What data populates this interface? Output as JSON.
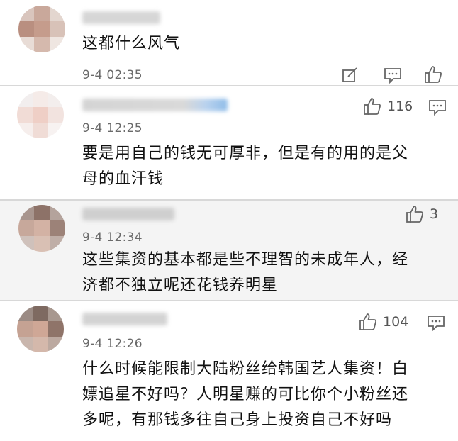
{
  "comments": [
    {
      "text_lines": [
        "这都什么风气"
      ],
      "time": "9-4 02:35",
      "likes": "",
      "icons": [
        "edit-icon",
        "comment-icon",
        "thumbs-up-icon"
      ]
    },
    {
      "text_lines": [
        "要是用自己的钱无可厚非，但是有的用的是父",
        "母的血汗钱"
      ],
      "time": "9-4 12:25",
      "likes": "116",
      "icons": [
        "thumbs-up-icon",
        "comment-icon"
      ]
    },
    {
      "text_lines": [
        "这些集资的基本都是些不理智的未成年人，经",
        "济都不独立呢还花钱养明星"
      ],
      "time": "9-4 12:34",
      "likes": "3",
      "icons": [
        "thumbs-up-icon"
      ]
    },
    {
      "text_lines": [
        "什么时候能限制大陆粉丝给韩国艺人集资！白",
        "嫖追星不好吗？人明星赚的可比你个小粉丝还",
        "多呢，有那钱多往自己身上投资自己不好吗"
      ],
      "time": "9-4 12:26",
      "likes": "104",
      "icons": [
        "thumbs-up-icon",
        "comment-icon"
      ]
    }
  ],
  "colors": {
    "background": "#ffffff",
    "highlight_row": "#f4f4f4",
    "divider": "#d8d8d8",
    "text": "#111111",
    "meta_text": "#6a6a6a",
    "icon_stroke": "#666666"
  }
}
